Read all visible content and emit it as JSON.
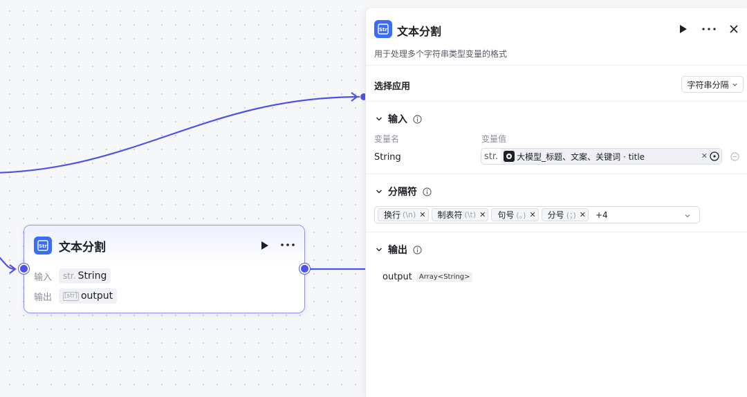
{
  "colors": {
    "accent": "#4d53e8",
    "node_border": "#8f8ff0",
    "app_icon": "#3b6cf6"
  },
  "node": {
    "icon": "str-app-icon",
    "title": "文本分割",
    "input_label": "输入",
    "input_type": "str.",
    "input_value": "String",
    "output_label": "输出",
    "output_type": "[str]",
    "output_value": "output"
  },
  "panel": {
    "icon": "str-app-icon",
    "title": "文本分割",
    "description": "用于处理多个字符串类型变量的格式",
    "select_app_label": "选择应用",
    "select_app_value": "字符串分隔",
    "input_section": {
      "title": "输入",
      "col_name": "变量名",
      "col_value": "变量值",
      "var_name": "String",
      "var_type": "str.",
      "var_ref": "大模型_标题、文案、关键词 · title"
    },
    "separator_section": {
      "title": "分隔符",
      "chips": [
        {
          "label": "换行",
          "symbol": "(\\n)"
        },
        {
          "label": "制表符",
          "symbol": "(\\t)"
        },
        {
          "label": "句号",
          "symbol": "(。)"
        },
        {
          "label": "分号",
          "symbol": "(；)"
        }
      ],
      "more": "+4"
    },
    "output_section": {
      "title": "输出",
      "name": "output",
      "type": "Array<String>"
    }
  }
}
